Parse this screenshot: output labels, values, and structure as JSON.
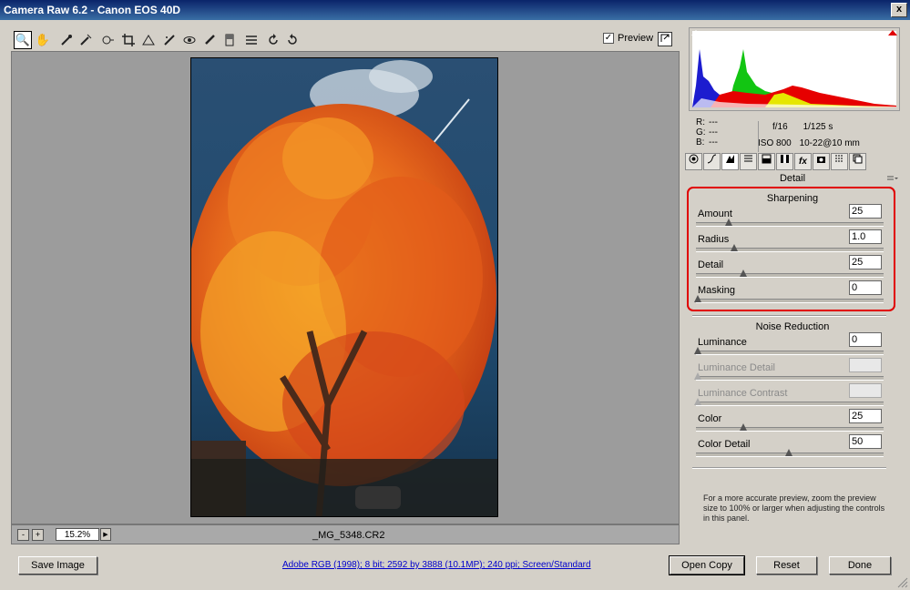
{
  "window": {
    "title": "Camera Raw 6.2  -  Canon EOS 40D",
    "close": "x"
  },
  "toolbar": {
    "preview_label": "Preview",
    "preview_checked": "✓",
    "zoom_glyph": "🔍",
    "hand_glyph": "✋"
  },
  "status": {
    "zoom": "15.2%",
    "minus": "-",
    "plus": "+",
    "menu": "▶",
    "filename": "_MG_5348.CR2"
  },
  "readouts": {
    "r_label": "R:",
    "r_value": "---",
    "g_label": "G:",
    "g_value": "---",
    "b_label": "B:",
    "b_value": "---",
    "aperture": "f/16",
    "shutter": "1/125 s",
    "iso": "ISO 800",
    "lens": "10-22@10 mm"
  },
  "panel": {
    "title": "Detail",
    "sharpening": {
      "title": "Sharpening",
      "rows": [
        {
          "label": "Amount",
          "value": "25",
          "pos": 0.17
        },
        {
          "label": "Radius",
          "value": "1.0",
          "pos": 0.2
        },
        {
          "label": "Detail",
          "value": "25",
          "pos": 0.25
        },
        {
          "label": "Masking",
          "value": "0",
          "pos": 0.0
        }
      ]
    },
    "noise": {
      "title": "Noise Reduction",
      "rows": [
        {
          "label": "Luminance",
          "value": "0",
          "pos": 0.0
        },
        {
          "label": "Luminance Detail",
          "value": "",
          "pos": 0.0,
          "disabled": true
        },
        {
          "label": "Luminance Contrast",
          "value": "",
          "pos": 0.0,
          "disabled": true
        },
        {
          "label": "Color",
          "value": "25",
          "pos": 0.25
        },
        {
          "label": "Color Detail",
          "value": "50",
          "pos": 0.5
        }
      ]
    },
    "hint": "For a more accurate preview, zoom the preview size to 100% or larger when adjusting the controls in this panel."
  },
  "bottom": {
    "save": "Save Image",
    "workflow": "Adobe RGB (1998); 8 bit; 2592 by 3888 (10.1MP); 240 ppi; Screen/Standard",
    "open": "Open Copy",
    "reset": "Reset",
    "done": "Done"
  },
  "colors": {
    "highlight_box": "#e00000",
    "title_bar": "#0a246a",
    "link": "#0000cc"
  }
}
